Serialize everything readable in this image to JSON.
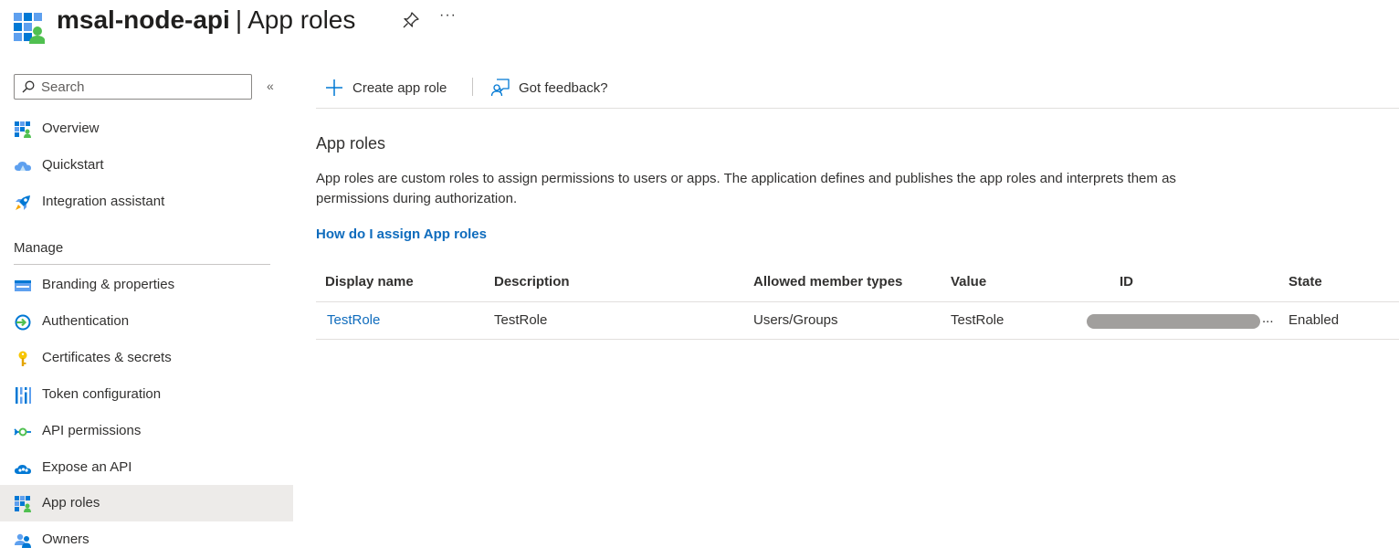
{
  "header": {
    "app_name": "msal-node-api",
    "separator": "|",
    "page_name": "App roles",
    "more": "···"
  },
  "sidebar": {
    "search_placeholder": "Search",
    "collapse": "«",
    "items": [
      {
        "label": "Overview",
        "icon": "overview-icon"
      },
      {
        "label": "Quickstart",
        "icon": "quickstart-cloud-icon"
      },
      {
        "label": "Integration assistant",
        "icon": "rocket-icon"
      }
    ],
    "manage_label": "Manage",
    "manage_items": [
      {
        "label": "Branding & properties",
        "icon": "branding-icon"
      },
      {
        "label": "Authentication",
        "icon": "authentication-icon"
      },
      {
        "label": "Certificates & secrets",
        "icon": "key-icon"
      },
      {
        "label": "Token configuration",
        "icon": "token-bars-icon"
      },
      {
        "label": "API permissions",
        "icon": "api-permissions-icon"
      },
      {
        "label": "Expose an API",
        "icon": "cloud-api-icon"
      },
      {
        "label": "App roles",
        "icon": "app-roles-icon",
        "selected": true
      },
      {
        "label": "Owners",
        "icon": "owners-icon"
      }
    ]
  },
  "toolbar": {
    "create_label": "Create app role",
    "feedback_label": "Got feedback?"
  },
  "main": {
    "section_title": "App roles",
    "description": "App roles are custom roles to assign permissions to users or apps. The application defines and publishes the app roles and interprets them as permissions during authorization.",
    "help_link": "How do I assign App roles"
  },
  "table": {
    "columns": [
      "Display name",
      "Description",
      "Allowed member types",
      "Value",
      "ID",
      "State"
    ],
    "rows": [
      {
        "display_name": "TestRole",
        "description": "TestRole",
        "allowed_member_types": "Users/Groups",
        "value": "TestRole",
        "id": "...",
        "state": "Enabled"
      }
    ]
  },
  "colors": {
    "link": "#0f6cbd",
    "selected_bg": "#edebe9",
    "border": "#e1dfdd"
  }
}
